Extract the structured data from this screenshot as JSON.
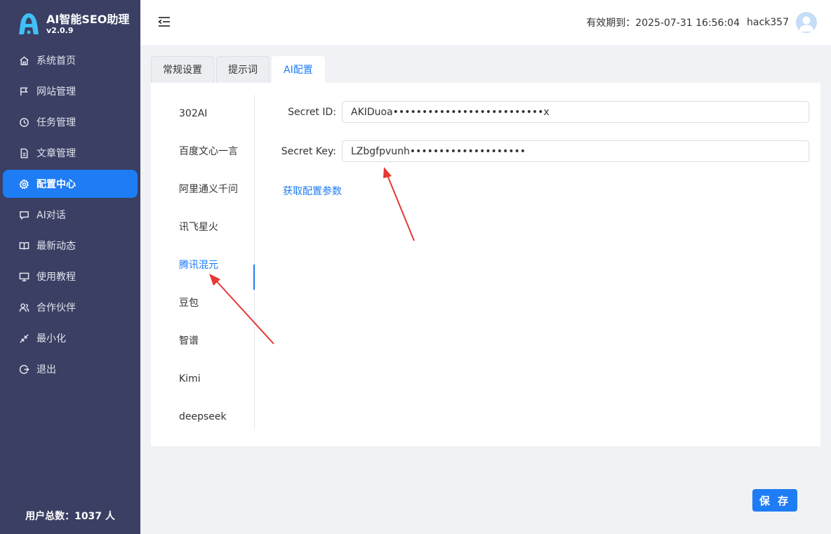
{
  "brand": {
    "name": "AI智能SEO助理",
    "version": "v2.0.9"
  },
  "menu": [
    {
      "label": "系统首页",
      "icon": "home-icon",
      "active": false
    },
    {
      "label": "网站管理",
      "icon": "flag-icon",
      "active": false
    },
    {
      "label": "任务管理",
      "icon": "clock-icon",
      "active": false
    },
    {
      "label": "文章管理",
      "icon": "document-icon",
      "active": false
    },
    {
      "label": "配置中心",
      "icon": "gear-icon",
      "active": true
    },
    {
      "label": "AI对话",
      "icon": "chat-icon",
      "active": false
    },
    {
      "label": "最新动态",
      "icon": "book-icon",
      "active": false
    },
    {
      "label": "使用教程",
      "icon": "monitor-icon",
      "active": false
    },
    {
      "label": "合作伙伴",
      "icon": "users-icon",
      "active": false
    },
    {
      "label": "最小化",
      "icon": "minimize-icon",
      "active": false
    },
    {
      "label": "退出",
      "icon": "logout-icon",
      "active": false
    }
  ],
  "footer": {
    "user_count": "用户总数：1037 人"
  },
  "header": {
    "expiry_label": "有效期到：2025-07-31 16:56:04",
    "username": "hack357"
  },
  "tabs": [
    {
      "label": "常规设置",
      "active": false
    },
    {
      "label": "提示词",
      "active": false
    },
    {
      "label": "AI配置",
      "active": true
    }
  ],
  "providers": [
    {
      "label": "302AI",
      "active": false
    },
    {
      "label": "百度文心一言",
      "active": false
    },
    {
      "label": "阿里通义千问",
      "active": false
    },
    {
      "label": "讯飞星火",
      "active": false
    },
    {
      "label": "腾讯混元",
      "active": true
    },
    {
      "label": "豆包",
      "active": false
    },
    {
      "label": "智谱",
      "active": false
    },
    {
      "label": "Kimi",
      "active": false
    },
    {
      "label": "deepseek",
      "active": false
    }
  ],
  "form": {
    "secret_id_label": "Secret ID:",
    "secret_id_value": "AKIDuoa••••••••••••••••••••••••••x",
    "secret_key_label": "Secret Key:",
    "secret_key_value": "LZbgfpvunh••••••••••••••••••••",
    "get_params_link": "获取配置参数"
  },
  "save_button": "保 存",
  "colors": {
    "accent": "#1e7cf5",
    "sidebar": "#3a3f63",
    "annotation": "#e53935"
  }
}
